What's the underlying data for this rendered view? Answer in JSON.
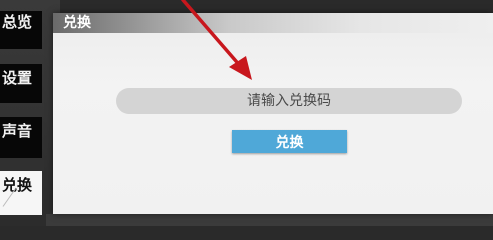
{
  "sidebar": {
    "items": [
      {
        "label": "总览",
        "active": false
      },
      {
        "label": "设置",
        "active": false
      },
      {
        "label": "声音",
        "active": false
      },
      {
        "label": "兑换",
        "active": true
      }
    ]
  },
  "panel": {
    "title": "兑换",
    "input": {
      "value": "",
      "placeholder": "请输入兑换码"
    },
    "redeem_button_label": "兑换"
  },
  "colors": {
    "accent": "#4fa8d8",
    "annotation_arrow": "#c8171d"
  }
}
